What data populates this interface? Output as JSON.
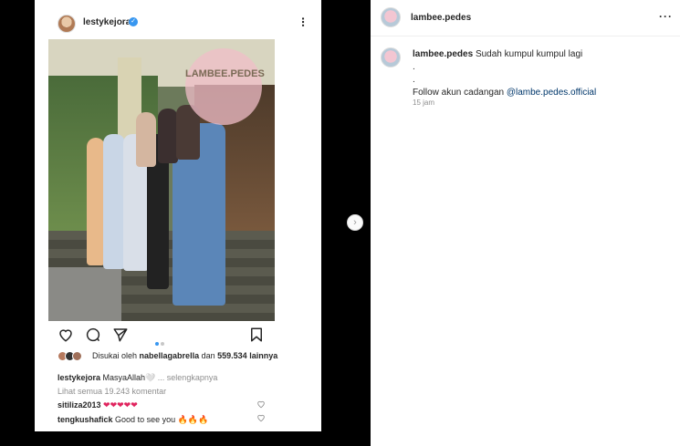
{
  "screenshot_post": {
    "username": "lestykejora",
    "watermark": "LAMBEE.PEDES",
    "liked_by_prefix": "Disukai oleh",
    "liked_by_user": "nabellagabrella",
    "liked_by_connector": "dan",
    "liked_by_count": "559.534",
    "liked_by_suffix": "lainnya",
    "caption_user": "lestykejora",
    "caption_text": "MasyaAllah🤍",
    "caption_more": "... selengkapnya",
    "view_all_comments": "Lihat semua 19.243 komentar",
    "comments": [
      {
        "user": "sitiliza2013",
        "text": "❤❤❤❤❤"
      },
      {
        "user": "tengkushafick",
        "text": "Good to see you 🔥🔥🔥"
      }
    ]
  },
  "panel": {
    "username": "lambee.pedes",
    "more_icon": "more-horizontal-icon",
    "caption_user": "lambee.pedes",
    "caption_text": "Sudah kumpul kumpul lagi",
    "caption_dot1": ".",
    "caption_dot2": ".",
    "caption_follow": "Follow akun cadangan",
    "caption_mention": "@lambe.pedes.official",
    "timestamp": "15 jam"
  },
  "colors": {
    "verified": "#3897f0",
    "mention": "#00376b",
    "hearts": "#e0245e"
  }
}
